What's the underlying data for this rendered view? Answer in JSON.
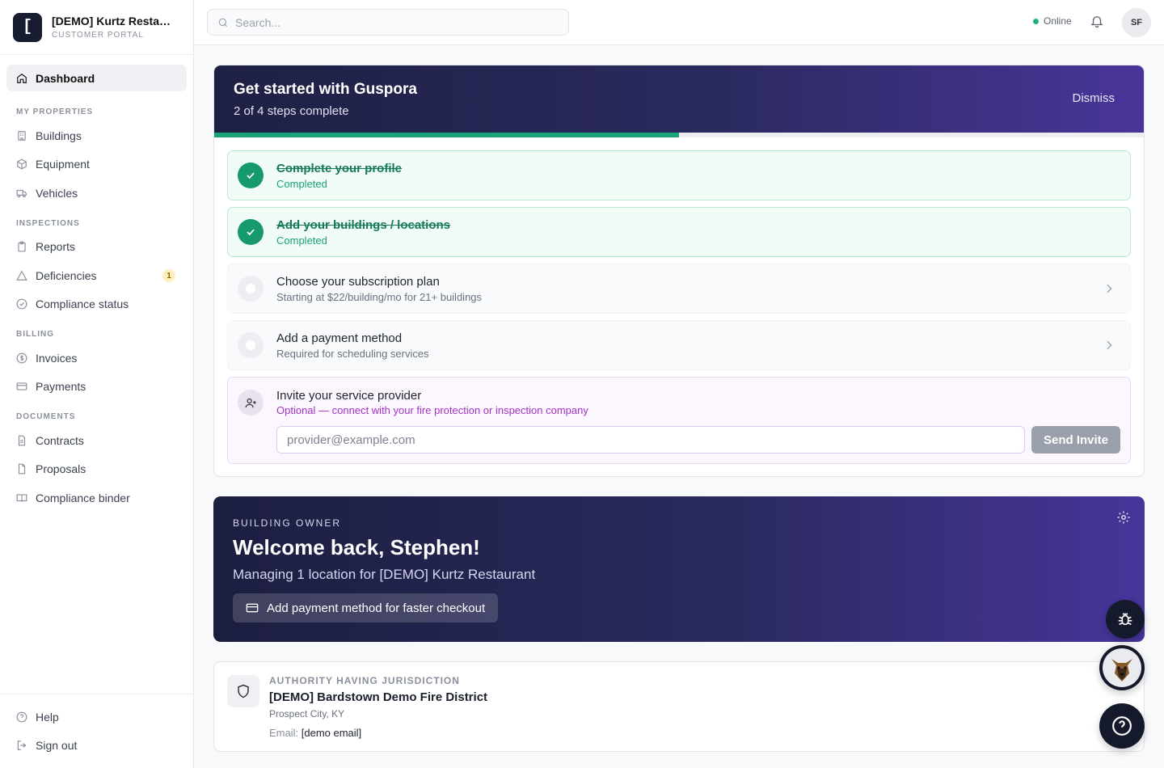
{
  "brand": {
    "logo": "[",
    "name": "[DEMO] Kurtz Restaur...",
    "subtitle": "CUSTOMER PORTAL"
  },
  "sidebar": {
    "dashboard": {
      "label": "Dashboard",
      "icon": "home-icon"
    },
    "sections": [
      {
        "title": "MY PROPERTIES",
        "items": [
          {
            "label": "Buildings",
            "icon": "building-icon"
          },
          {
            "label": "Equipment",
            "icon": "package-icon"
          },
          {
            "label": "Vehicles",
            "icon": "truck-icon"
          }
        ]
      },
      {
        "title": "INSPECTIONS",
        "items": [
          {
            "label": "Reports",
            "icon": "clipboard-icon"
          },
          {
            "label": "Deficiencies",
            "icon": "warning-icon",
            "badge": "1"
          },
          {
            "label": "Compliance status",
            "icon": "check-circle-icon"
          }
        ]
      },
      {
        "title": "BILLING",
        "items": [
          {
            "label": "Invoices",
            "icon": "dollar-circle-icon"
          },
          {
            "label": "Payments",
            "icon": "card-icon"
          }
        ]
      },
      {
        "title": "DOCUMENTS",
        "items": [
          {
            "label": "Contracts",
            "icon": "file-icon"
          },
          {
            "label": "Proposals",
            "icon": "document-icon"
          },
          {
            "label": "Compliance binder",
            "icon": "book-icon"
          }
        ]
      }
    ],
    "bottom": [
      {
        "label": "Help",
        "icon": "help-icon"
      },
      {
        "label": "Sign out",
        "icon": "logout-icon"
      }
    ]
  },
  "header": {
    "search_placeholder": "Search...",
    "status": "Online",
    "avatar": "SF",
    "status_color": "#22b07d"
  },
  "get_started": {
    "title": "Get started with Guspora",
    "subtitle": "2 of 4 steps complete",
    "dismiss": "Dismiss",
    "progress": 0.5,
    "steps": [
      {
        "title": "Complete your profile",
        "desc": "Completed",
        "done": true
      },
      {
        "title": "Add your buildings / locations",
        "desc": "Completed",
        "done": true
      },
      {
        "title": "Choose your subscription plan",
        "desc": "Starting at $22/building/mo for 21+ buildings",
        "done": false
      },
      {
        "title": "Add a payment method",
        "desc": "Required for scheduling services",
        "done": false
      }
    ],
    "invite": {
      "title": "Invite your service provider",
      "desc": "Optional — connect with your fire protection or inspection company",
      "placeholder": "provider@example.com",
      "button": "Send Invite"
    }
  },
  "welcome": {
    "role": "BUILDING OWNER",
    "title": "Welcome back, Stephen!",
    "subtitle": "Managing 1 location for [DEMO] Kurtz Restaurant",
    "button": "Add payment method for faster checkout"
  },
  "authority": {
    "label": "AUTHORITY HAVING JURISDICTION",
    "name": "[DEMO] Bardstown Demo Fire District",
    "city": "Prospect City, KY",
    "email_label": "Email:",
    "email_value": "[demo email]"
  }
}
